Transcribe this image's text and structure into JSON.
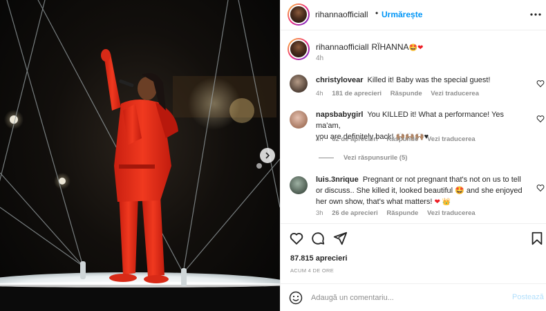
{
  "media": {
    "description_icon": "photo-slide",
    "next_label": "next-slide"
  },
  "header": {
    "username": "rihannaofficiall",
    "separator": "•",
    "follow": "Urmărește"
  },
  "caption": {
    "username": "rihannaofficiall",
    "text": "RÏHANNA",
    "emoji": "🤩",
    "heart": "❤",
    "time": "4h"
  },
  "comments": [
    {
      "username": "christylovear",
      "text": "Killed it! Baby was the special guest!",
      "time": "4h",
      "likes": "181 de aprecieri",
      "reply": "Răspunde",
      "translate": "Vezi traducerea"
    },
    {
      "username": "napsbabygirl",
      "text_line1": "You KILLED it! What a performance! Yes ma'am,",
      "text_line2": "you are definitely back! 🙌🏽🙌🏽🙌🏽♥",
      "time": "4h",
      "likes": "62 de aprecieri",
      "reply": "Răspunde",
      "translate": "Vezi traducerea",
      "view_replies": "Vezi răspunsurile (5)"
    },
    {
      "username": "luis.3nrique",
      "text_line1": "Pregnant or not pregnant that's not on us to tell",
      "text_line2": "or discuss.. She killed it, looked beautiful 🤩 and she enjoyed",
      "text_line3": "her own show, that's what matters!",
      "end_heart": "❤",
      "end_crown": "👑",
      "time": "3h",
      "likes": "26 de aprecieri",
      "reply": "Răspunde",
      "translate": "Vezi traducerea"
    }
  ],
  "actions": {
    "likes": "87.815 aprecieri",
    "ago": "ACUM 4 DE ORE"
  },
  "add_comment": {
    "placeholder": "Adaugă un comentariu...",
    "post": "Postează"
  },
  "colors": {
    "accent": "#0095f6",
    "muted": "#8e8e8e",
    "text": "#262626",
    "outfit": "#e8321e",
    "post_disabled": "#b2dffc"
  }
}
